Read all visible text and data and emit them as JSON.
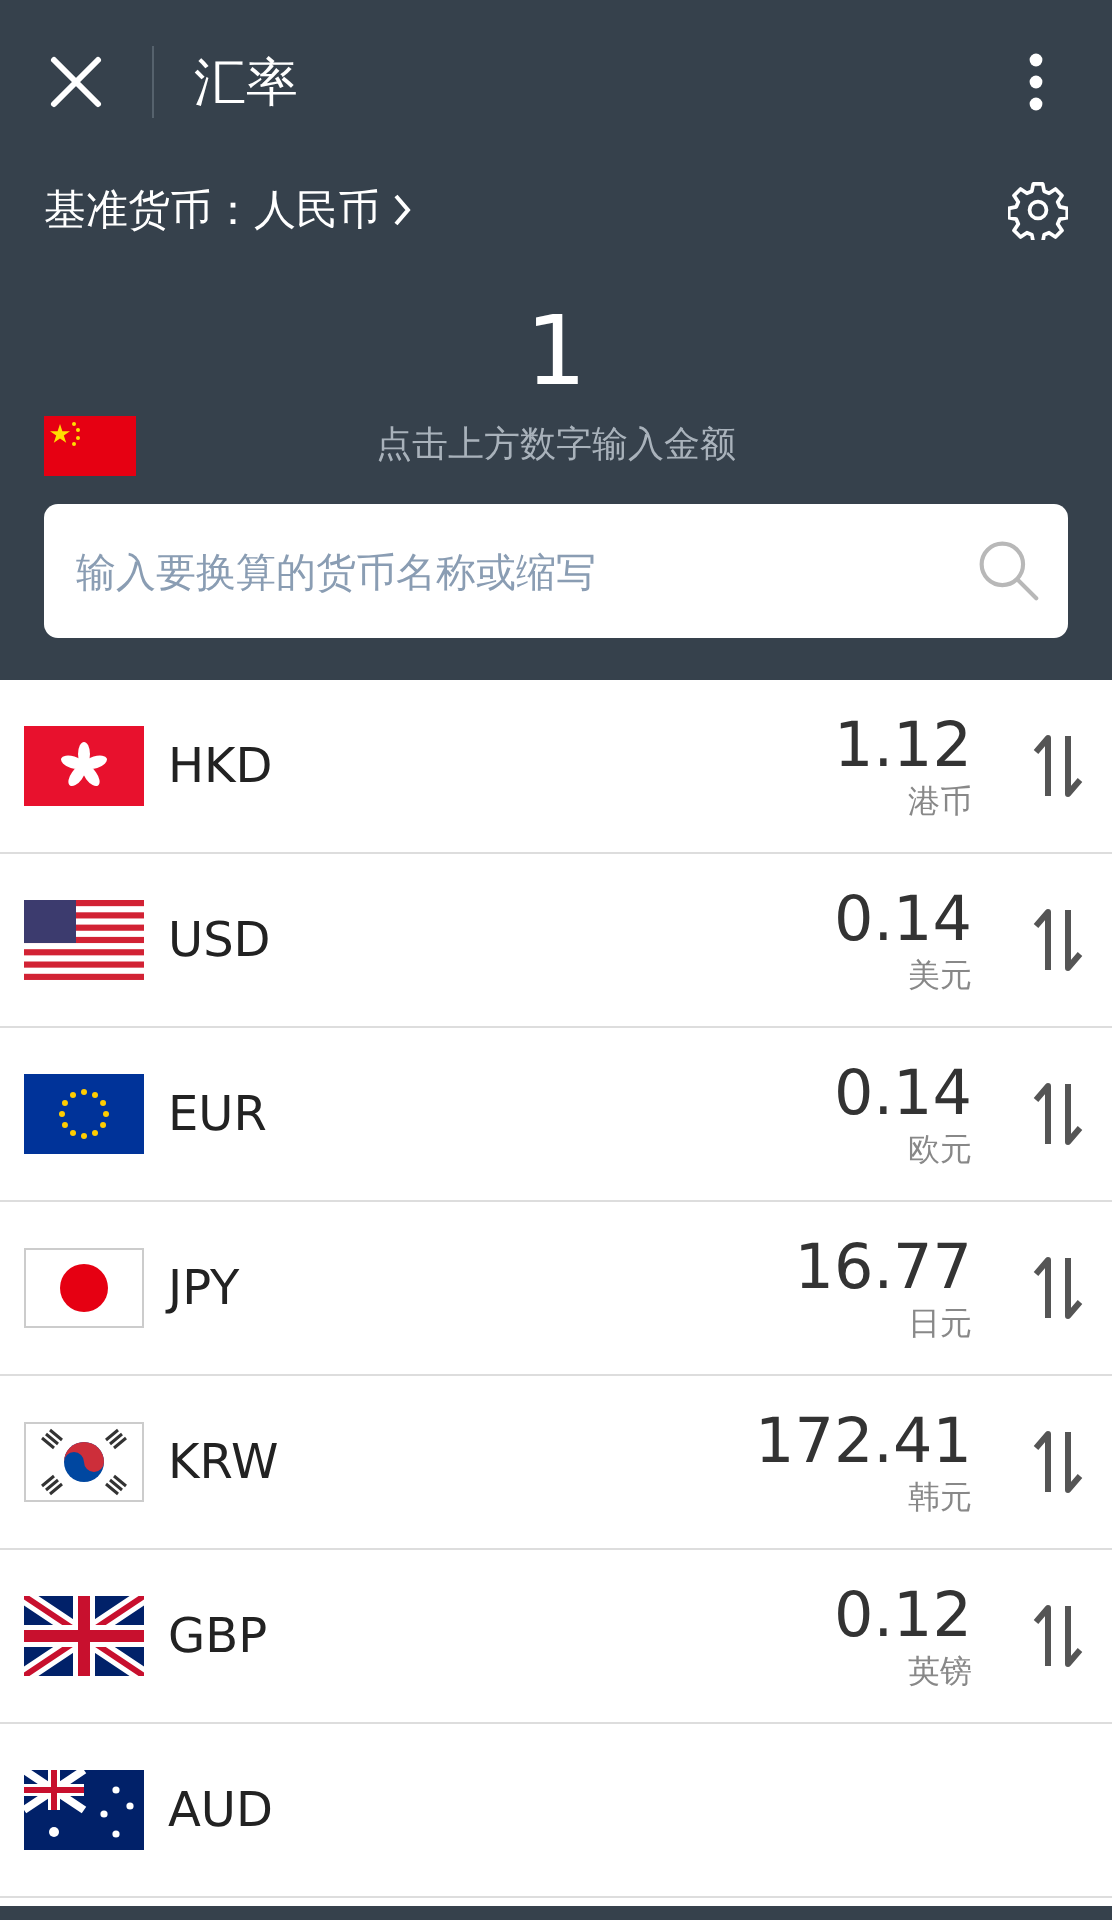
{
  "header": {
    "title": "汇率",
    "base_label": "基准货币：人民币",
    "amount": "1",
    "hint": "点击上方数字输入金额"
  },
  "search": {
    "placeholder": "输入要换算的货币名称或缩写"
  },
  "rates": [
    {
      "code": "HKD",
      "value": "1.12",
      "name": "港币"
    },
    {
      "code": "USD",
      "value": "0.14",
      "name": "美元"
    },
    {
      "code": "EUR",
      "value": "0.14",
      "name": "欧元"
    },
    {
      "code": "JPY",
      "value": "16.77",
      "name": "日元"
    },
    {
      "code": "KRW",
      "value": "172.41",
      "name": "韩元"
    },
    {
      "code": "GBP",
      "value": "0.12",
      "name": "英镑"
    },
    {
      "code": "AUD"
    }
  ]
}
